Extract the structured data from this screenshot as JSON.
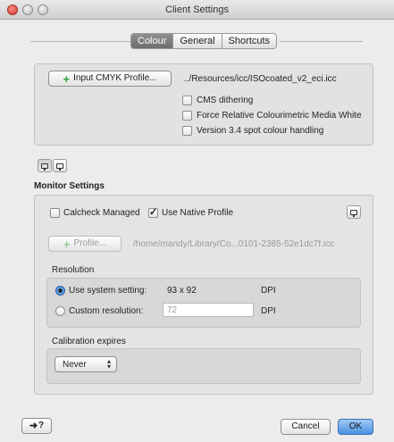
{
  "window": {
    "title": "Client Settings"
  },
  "tabs": [
    {
      "label": "Colour",
      "active": true
    },
    {
      "label": "General",
      "active": false
    },
    {
      "label": "Shortcuts",
      "active": false
    }
  ],
  "colour": {
    "input_button": "Input CMYK Profile...",
    "input_path": "../Resources/icc/ISOcoated_v2_eci.icc",
    "options": [
      {
        "label": "CMS dithering",
        "checked": false
      },
      {
        "label": "Force Relative Colourimetric Media White",
        "checked": false
      },
      {
        "label": "Version 3.4 spot colour handling",
        "checked": false
      }
    ]
  },
  "monitor": {
    "heading": "Monitor Settings",
    "calcheck_label": "Calcheck Managed",
    "calcheck_checked": false,
    "native_label": "Use Native Profile",
    "native_checked": true,
    "profile_button": "Profile...",
    "profile_path": "/home/mandy/Library/Co...0101-2385-52e1dc7f.icc",
    "resolution": {
      "heading": "Resolution",
      "system_label": "Use system setting:",
      "system_value": "93 x 92",
      "system_unit": "DPI",
      "custom_label": "Custom resolution:",
      "custom_value": "72",
      "custom_unit": "DPI",
      "selected": "system"
    },
    "calibration": {
      "heading": "Calibration expires",
      "value": "Never"
    }
  },
  "footer": {
    "help_label": "?",
    "cancel_label": "Cancel",
    "ok_label": "OK"
  },
  "colors": {
    "accent": "#4a8fe0",
    "add_icon": "#2aa22a"
  }
}
